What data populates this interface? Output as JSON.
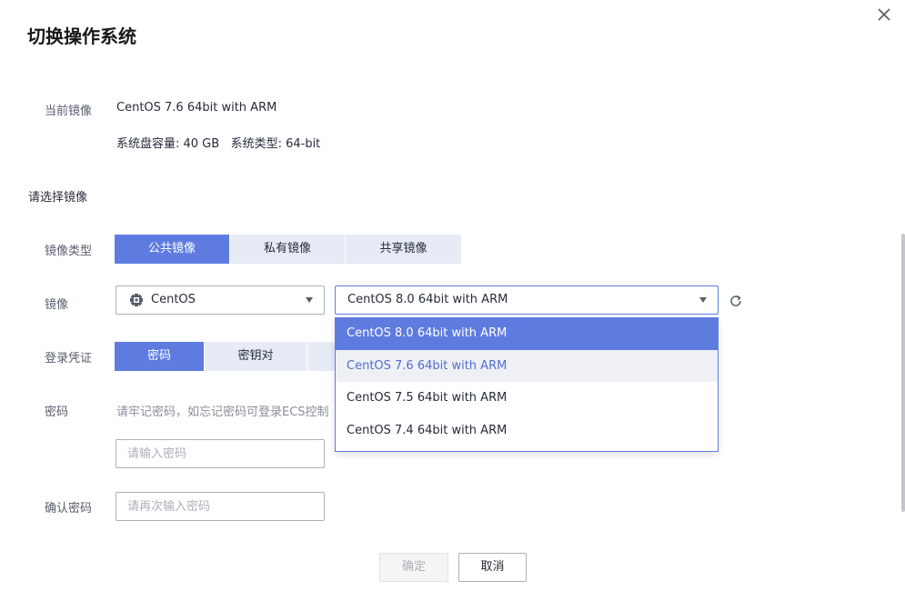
{
  "dialog": {
    "title": "切换操作系统"
  },
  "current_image": {
    "label": "当前镜像",
    "value": "CentOS 7.6 64bit with ARM",
    "details": "系统盘容量: 40 GB   系统类型: 64-bit"
  },
  "select_section": {
    "heading": "请选择镜像"
  },
  "image_type": {
    "label": "镜像类型",
    "options": [
      "公共镜像",
      "私有镜像",
      "共享镜像"
    ],
    "selected": "公共镜像"
  },
  "image": {
    "label": "镜像",
    "os_value": "CentOS",
    "version_value": "CentOS 8.0 64bit with ARM",
    "dropdown_options": [
      "CentOS 8.0 64bit with ARM",
      "CentOS 7.6 64bit with ARM",
      "CentOS 7.5 64bit with ARM",
      "CentOS 7.4 64bit with ARM"
    ]
  },
  "login": {
    "label": "登录凭证",
    "options": [
      "密码",
      "密钥对"
    ],
    "selected": "密码"
  },
  "password": {
    "label": "密码",
    "hint": "请牢记密码，如忘记密码可登录ECS控制",
    "placeholder": "请输入密码"
  },
  "confirm_password": {
    "label": "确认密码",
    "placeholder": "请再次输入密码"
  },
  "buttons": {
    "confirm": "确定",
    "cancel": "取消"
  },
  "colors": {
    "primary": "#5e7ce0",
    "segment_bg": "#e6ebf5",
    "hover_bg": "#eef0f5"
  }
}
